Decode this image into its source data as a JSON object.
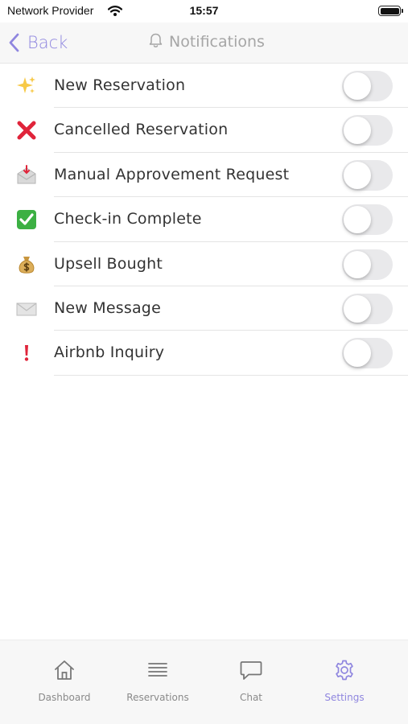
{
  "status_bar": {
    "carrier": "Network Provider",
    "time": "15:57"
  },
  "nav": {
    "back_label": "Back",
    "title": "Notifications",
    "accent": "#8f86df"
  },
  "notifications": [
    {
      "icon": "sparkles-icon",
      "label": "New Reservation",
      "enabled": false
    },
    {
      "icon": "cross-mark-icon",
      "label": "Cancelled Reservation",
      "enabled": false
    },
    {
      "icon": "inbox-tray-icon",
      "label": "Manual Approvement Request",
      "enabled": false
    },
    {
      "icon": "check-mark-icon",
      "label": "Check-in Complete",
      "enabled": false
    },
    {
      "icon": "money-bag-icon",
      "label": "Upsell Bought",
      "enabled": false
    },
    {
      "icon": "envelope-icon",
      "label": "New Message",
      "enabled": false
    },
    {
      "icon": "exclamation-icon",
      "label": "Airbnb Inquiry",
      "enabled": false
    }
  ],
  "tabbar": {
    "active": "Settings",
    "tabs": [
      {
        "icon": "home-icon",
        "label": "Dashboard"
      },
      {
        "icon": "list-icon",
        "label": "Reservations"
      },
      {
        "icon": "chat-icon",
        "label": "Chat"
      },
      {
        "icon": "gear-icon",
        "label": "Settings"
      }
    ]
  }
}
